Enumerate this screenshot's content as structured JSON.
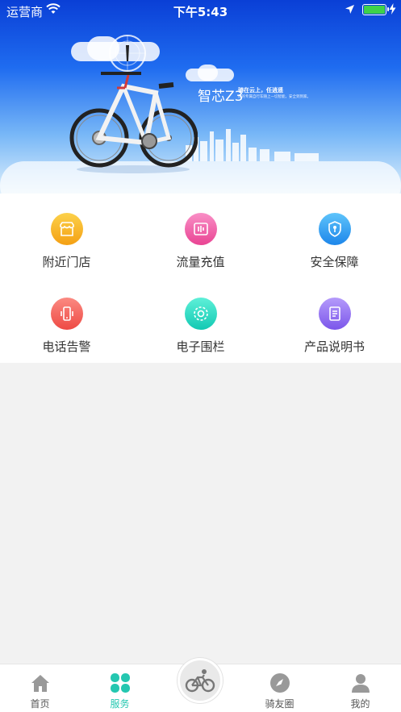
{
  "status_bar": {
    "carrier": "运营商",
    "time": "下午5:43",
    "battery_level": 1.0
  },
  "banner": {
    "brand": "智芯Z3",
    "slogan": "骑在云上，任逍遥",
    "sub": "你的专属自行车随上一切智能，安全到到家。"
  },
  "services": [
    {
      "label": "附近门店",
      "icon": "store-icon",
      "color": "#f7b21b"
    },
    {
      "label": "流量充值",
      "icon": "data-recharge-icon",
      "color": "#ee5aa6"
    },
    {
      "label": "安全保障",
      "icon": "shield-icon",
      "color": "#2d9cf0"
    },
    {
      "label": "电话告警",
      "icon": "phone-alarm-icon",
      "color": "#f4645a"
    },
    {
      "label": "电子围栏",
      "icon": "geofence-icon",
      "color": "#22d6c1"
    },
    {
      "label": "产品说明书",
      "icon": "manual-icon",
      "color": "#8b6cf0"
    }
  ],
  "tabbar": {
    "tabs": [
      {
        "label": "首页",
        "icon": "home-icon"
      },
      {
        "label": "服务",
        "icon": "clover-icon",
        "active": true
      },
      {
        "label": "",
        "icon": "bike-icon"
      },
      {
        "label": "骑友圈",
        "icon": "compass-icon"
      },
      {
        "label": "我的",
        "icon": "person-icon"
      }
    ],
    "accent": "#24c7b0"
  }
}
